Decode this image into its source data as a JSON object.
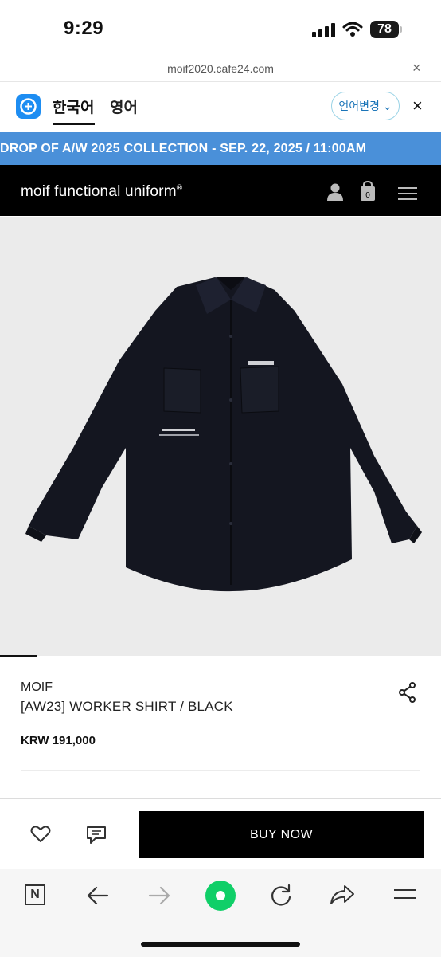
{
  "status_bar": {
    "time": "9:29",
    "battery": "78"
  },
  "url_bar": {
    "url": "moif2020.cafe24.com",
    "close_label": "×"
  },
  "translate_bar": {
    "languages": [
      "한국어",
      "영어"
    ],
    "change_language_label": "언어변경",
    "close_label": "×"
  },
  "marquee": {
    "text": "DROP OF A/W 2025 COLLECTION - SEP. 22, 2025 / 11:00AM"
  },
  "header": {
    "brand": "moif functional uniform",
    "brand_mark": "®",
    "cart_count": "0"
  },
  "product": {
    "brand": "MOIF",
    "name": "[AW23] WORKER SHIRT / BLACK",
    "price": "KRW 191,000",
    "image_icon": "black-worker-shirt-photo"
  },
  "actions": {
    "buy_label": "BUY NOW"
  },
  "colors": {
    "marquee_bg": "#4a90d9",
    "header_bg": "#000000",
    "buy_bg": "#000000",
    "home_button": "#10cf68"
  }
}
